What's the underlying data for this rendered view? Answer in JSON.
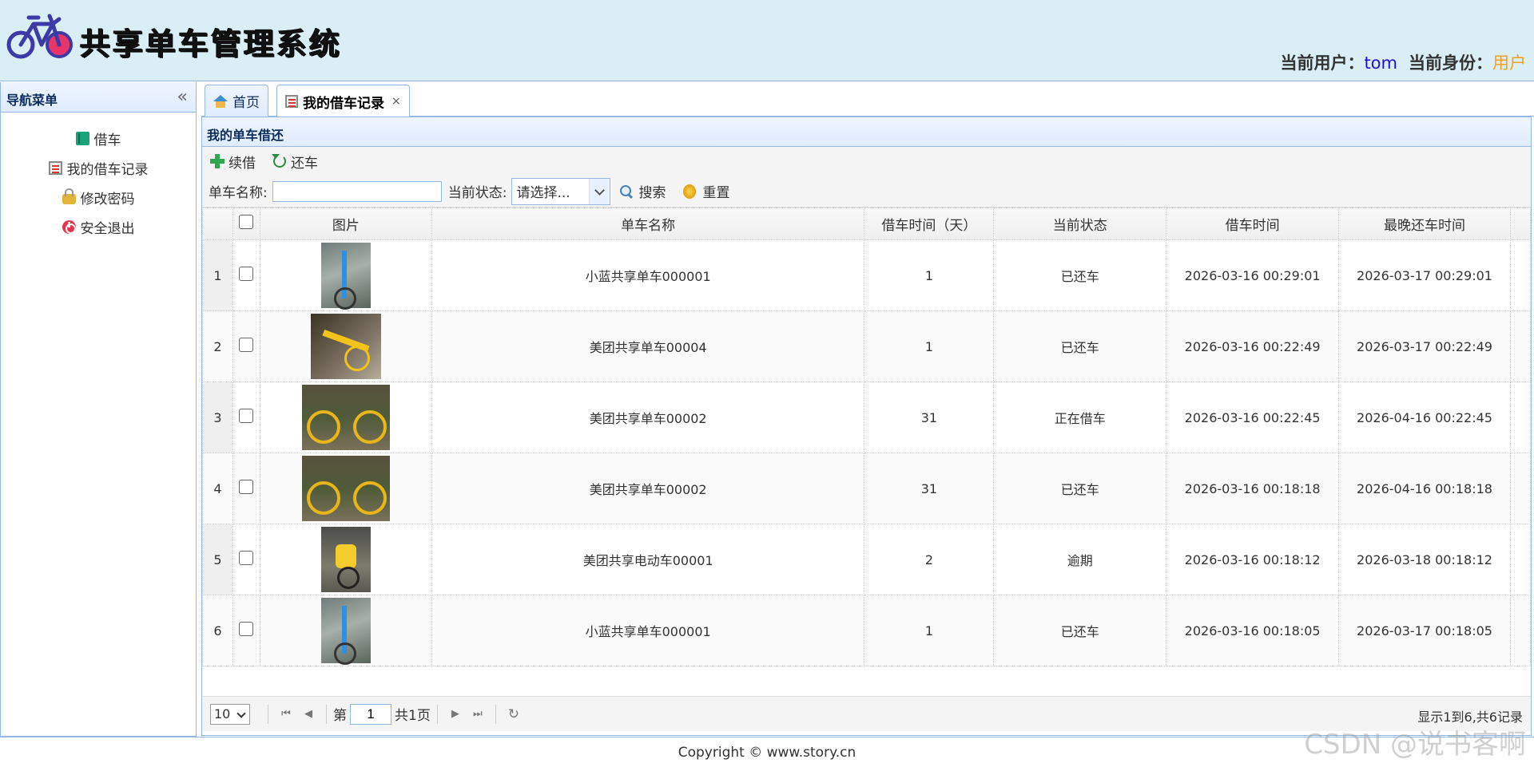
{
  "header": {
    "app_title": "共享单车管理系统",
    "user_label": "当前用户：",
    "user_value": "tom",
    "role_label": "当前身份：",
    "role_value": "用户"
  },
  "sidebar": {
    "title": "导航菜单",
    "items": [
      {
        "label": "借车",
        "icon": "book-icon"
      },
      {
        "label": "我的借车记录",
        "icon": "record-icon"
      },
      {
        "label": "修改密码",
        "icon": "lock-icon"
      },
      {
        "label": "安全退出",
        "icon": "power-icon"
      }
    ]
  },
  "tabs": [
    {
      "label": "首页",
      "icon": "home-icon"
    },
    {
      "label": "我的借车记录",
      "icon": "record-icon",
      "close": "×"
    }
  ],
  "panel": {
    "title": "我的单车借还",
    "toolbar": {
      "renew_label": "续借",
      "return_label": "还车"
    },
    "search": {
      "name_label": "单车名称:",
      "name_value": "",
      "status_label": "当前状态:",
      "status_value": "请选择...",
      "search_label": "搜索",
      "reset_label": "重置"
    },
    "columns": [
      "图片",
      "单车名称",
      "借车时间（天）",
      "当前状态",
      "借车时间",
      "最晚还车时间"
    ],
    "rows": [
      {
        "no": "1",
        "name": "小蓝共享单车000001",
        "days": "1",
        "status": "已还车",
        "status_type": "returned",
        "borrow_time": "2026-03-16 00:29:01",
        "due_time": "2026-03-17 00:29:01",
        "image": "bike-blue"
      },
      {
        "no": "2",
        "name": "美团共享单车00004",
        "days": "1",
        "status": "已还车",
        "status_type": "returned",
        "borrow_time": "2026-03-16 00:22:49",
        "due_time": "2026-03-17 00:22:49",
        "image": "bike-yellow1"
      },
      {
        "no": "3",
        "name": "美团共享单车00002",
        "days": "31",
        "status": "正在借车",
        "status_type": "borrowing",
        "borrow_time": "2026-03-16 00:22:45",
        "due_time": "2026-04-16 00:22:45",
        "image": "bike-yellow2"
      },
      {
        "no": "4",
        "name": "美团共享单车00002",
        "days": "31",
        "status": "已还车",
        "status_type": "returned",
        "borrow_time": "2026-03-16 00:18:18",
        "due_time": "2026-04-16 00:18:18",
        "image": "bike-yellow2"
      },
      {
        "no": "5",
        "name": "美团共享电动车00001",
        "days": "2",
        "status": "逾期",
        "status_type": "overdue",
        "borrow_time": "2026-03-16 00:18:12",
        "due_time": "2026-03-18 00:18:12",
        "image": "bike-ebike"
      },
      {
        "no": "6",
        "name": "小蓝共享单车000001",
        "days": "1",
        "status": "已还车",
        "status_type": "returned",
        "borrow_time": "2026-03-16 00:18:05",
        "due_time": "2026-03-17 00:18:05",
        "image": "bike-blue"
      }
    ],
    "pager": {
      "page_size": "10",
      "page_prefix": "第",
      "page_value": "1",
      "page_total": "共1页",
      "info": "显示1到6,共6记录"
    }
  },
  "footer": {
    "copyright": "Copyright © www.story.cn"
  },
  "watermark": "CSDN @说书客啊",
  "colors": {
    "header_bg": "#daeef5",
    "border": "#95b8e7",
    "status_returned": "#159578",
    "status_borrowing": "#1517c7",
    "status_overdue": "#e41919",
    "role": "#f79e1b",
    "user": "#1f10d8"
  }
}
